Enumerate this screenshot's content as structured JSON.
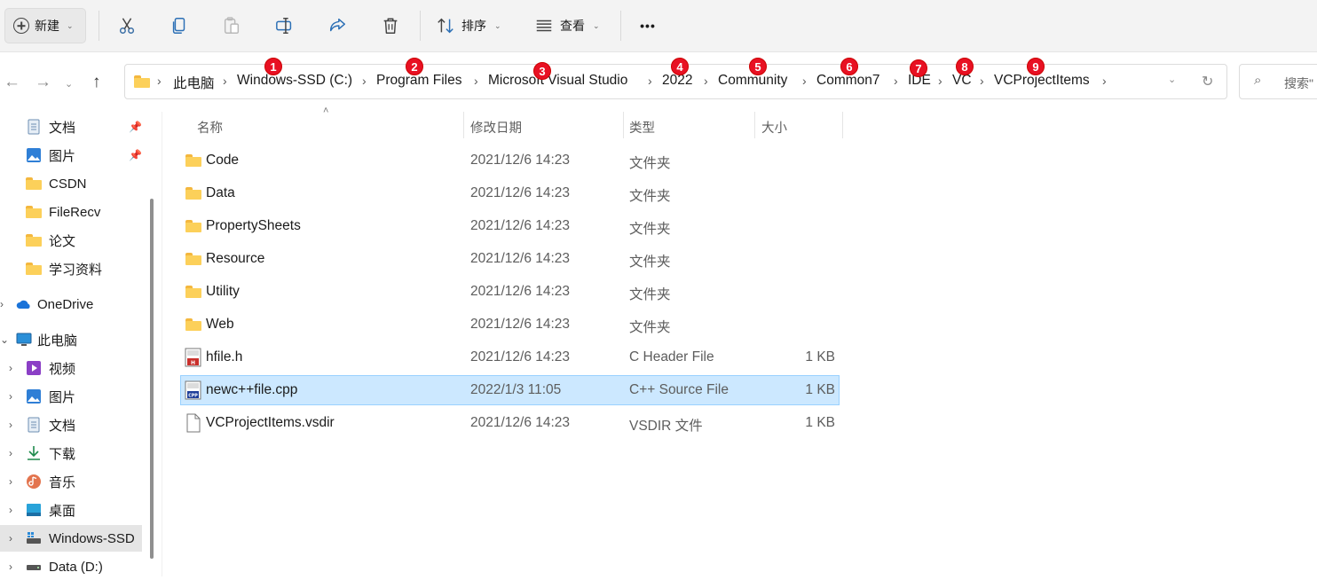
{
  "toolbar": {
    "new_label": "新建",
    "cut_icon": "scissors-icon",
    "copy_icon": "copy-icon",
    "paste_icon": "paste-icon",
    "rename_icon": "rename-icon",
    "share_icon": "share-icon",
    "delete_icon": "trash-icon",
    "sort_label": "排序",
    "view_label": "查看",
    "more_label": "•••"
  },
  "address": {
    "breadcrumbs": [
      {
        "label": "此电脑"
      },
      {
        "label": "Windows-SSD (C:)",
        "badge": "1"
      },
      {
        "label": "Program Files",
        "badge": "2"
      },
      {
        "label": "Microsoft Visual Studio",
        "badge": "3"
      },
      {
        "label": "2022",
        "badge": "4"
      },
      {
        "label": "Community",
        "badge": "5"
      },
      {
        "label": "Common7",
        "badge": "6"
      },
      {
        "label": "IDE",
        "badge": "7"
      },
      {
        "label": "VC",
        "badge": "8"
      },
      {
        "label": "VCProjectItems",
        "badge": "9"
      }
    ],
    "search_placeholder": "搜索\""
  },
  "sidebar": {
    "items": [
      {
        "label": "文档",
        "icon": "document-icon",
        "pinned": true
      },
      {
        "label": "图片",
        "icon": "picture-icon",
        "pinned": true
      },
      {
        "label": "CSDN",
        "icon": "folder-icon"
      },
      {
        "label": "FileRecv",
        "icon": "folder-icon"
      },
      {
        "label": "论文",
        "icon": "folder-icon"
      },
      {
        "label": "学习资料",
        "icon": "folder-icon"
      },
      {
        "label": "OneDrive",
        "icon": "cloud-icon"
      },
      {
        "label": "此电脑",
        "icon": "computer-icon"
      },
      {
        "label": "视频",
        "icon": "video-icon"
      },
      {
        "label": "图片",
        "icon": "picture-icon"
      },
      {
        "label": "文档",
        "icon": "document-icon"
      },
      {
        "label": "下载",
        "icon": "download-icon"
      },
      {
        "label": "音乐",
        "icon": "music-icon"
      },
      {
        "label": "桌面",
        "icon": "desktop-icon"
      },
      {
        "label": "Windows-SSD",
        "icon": "drive-icon",
        "selected": true
      },
      {
        "label": "Data (D:)",
        "icon": "drive-icon"
      }
    ]
  },
  "columns": {
    "name": "名称",
    "date": "修改日期",
    "type": "类型",
    "size": "大小"
  },
  "files": [
    {
      "name": "Code",
      "date": "2021/12/6 14:23",
      "type": "文件夹",
      "size": "",
      "icon": "folder-icon"
    },
    {
      "name": "Data",
      "date": "2021/12/6 14:23",
      "type": "文件夹",
      "size": "",
      "icon": "folder-icon"
    },
    {
      "name": "PropertySheets",
      "date": "2021/12/6 14:23",
      "type": "文件夹",
      "size": "",
      "icon": "folder-icon"
    },
    {
      "name": "Resource",
      "date": "2021/12/6 14:23",
      "type": "文件夹",
      "size": "",
      "icon": "folder-icon"
    },
    {
      "name": "Utility",
      "date": "2021/12/6 14:23",
      "type": "文件夹",
      "size": "",
      "icon": "folder-icon"
    },
    {
      "name": "Web",
      "date": "2021/12/6 14:23",
      "type": "文件夹",
      "size": "",
      "icon": "folder-icon"
    },
    {
      "name": "hfile.h",
      "date": "2021/12/6 14:23",
      "type": "C Header File",
      "size": "1 KB",
      "icon": "h-file-icon"
    },
    {
      "name": "newc++file.cpp",
      "date": "2022/1/3 11:05",
      "type": "C++ Source File",
      "size": "1 KB",
      "icon": "cpp-file-icon",
      "selected": true
    },
    {
      "name": "VCProjectItems.vsdir",
      "date": "2021/12/6 14:23",
      "type": "VSDIR 文件",
      "size": "1 KB",
      "icon": "blank-file-icon"
    }
  ]
}
